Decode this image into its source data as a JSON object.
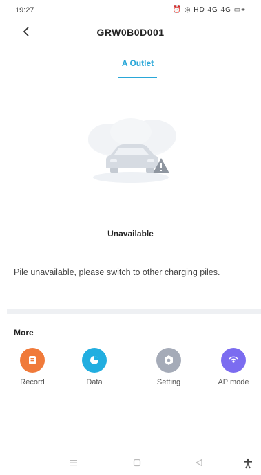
{
  "status_bar": {
    "time": "19:27",
    "icons_text": "⏰ ◎ HD 4G 4G ▭+"
  },
  "header": {
    "title": "GRW0B0D001"
  },
  "tabs": [
    {
      "label": "A Outlet",
      "active": true
    }
  ],
  "pile_status": {
    "label": "Unavailable",
    "message": "Pile unavailable, please switch to other charging piles."
  },
  "more": {
    "title": "More",
    "actions": [
      {
        "label": "Record",
        "icon": "record-icon",
        "color": "#f07a3a"
      },
      {
        "label": "Data",
        "icon": "data-icon",
        "color": "#22aee0"
      },
      {
        "label": "Setting",
        "icon": "gear-icon",
        "color": "#a5abb8"
      },
      {
        "label": "AP mode",
        "icon": "ap-mode-icon",
        "color": "#7b6cf0"
      }
    ]
  },
  "colors": {
    "accent": "#2aa7d8",
    "divider": "#eef0f3"
  }
}
